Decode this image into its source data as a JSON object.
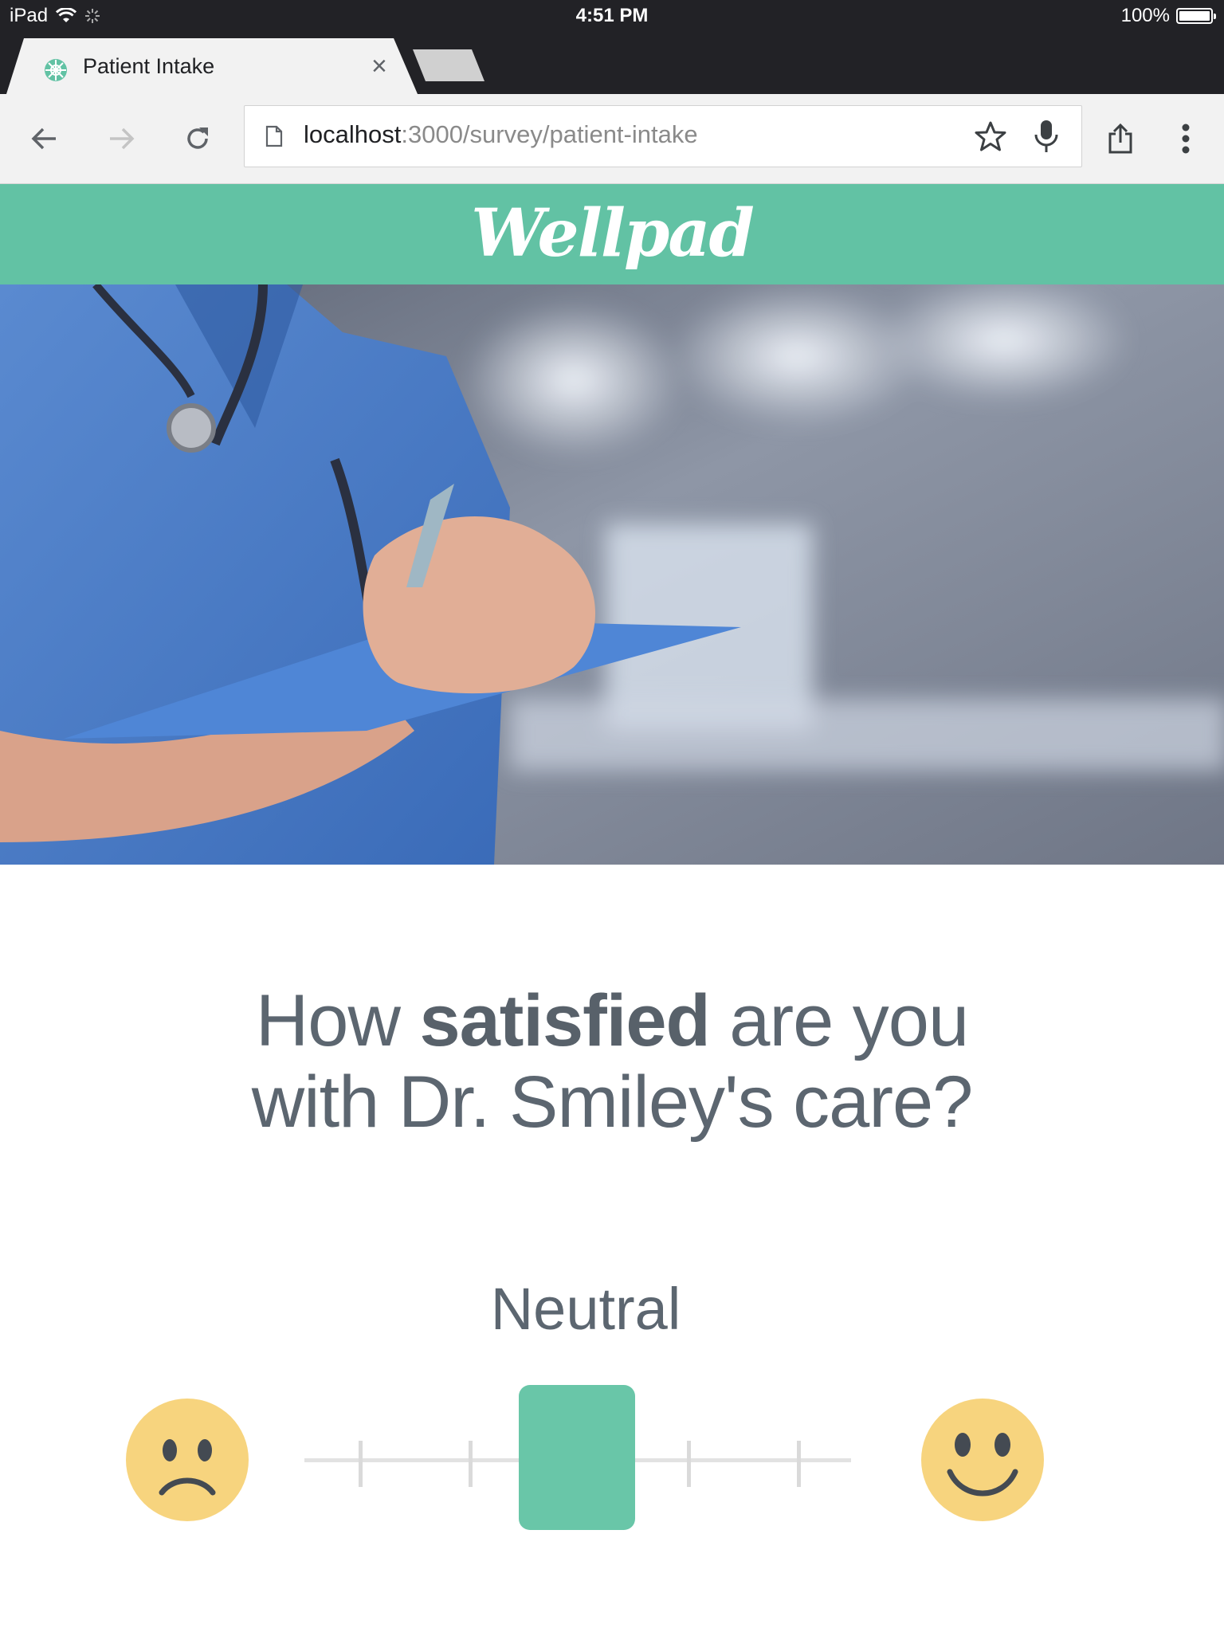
{
  "status_bar": {
    "device": "iPad",
    "time": "4:51 PM",
    "battery": "100%"
  },
  "browser": {
    "tab_title": "Patient Intake",
    "tab_close": "×",
    "url_host": "localhost",
    "url_path": ":3000/survey/patient-intake"
  },
  "page": {
    "brand": "Wellpad",
    "question_pre": "How ",
    "question_bold": "satisfied",
    "question_post_line1": " are you",
    "question_line2": "with Dr. Smiley's care?",
    "rating": {
      "current_label": "Neutral",
      "steps": 5,
      "selected_step": 3,
      "min_icon": "sad-face-icon",
      "max_icon": "happy-face-icon"
    }
  },
  "colors": {
    "brand_green": "#62c2a4",
    "slider_thumb": "#69c6a8",
    "face_yellow": "#f7d47e",
    "text_gray": "#5c6670"
  }
}
